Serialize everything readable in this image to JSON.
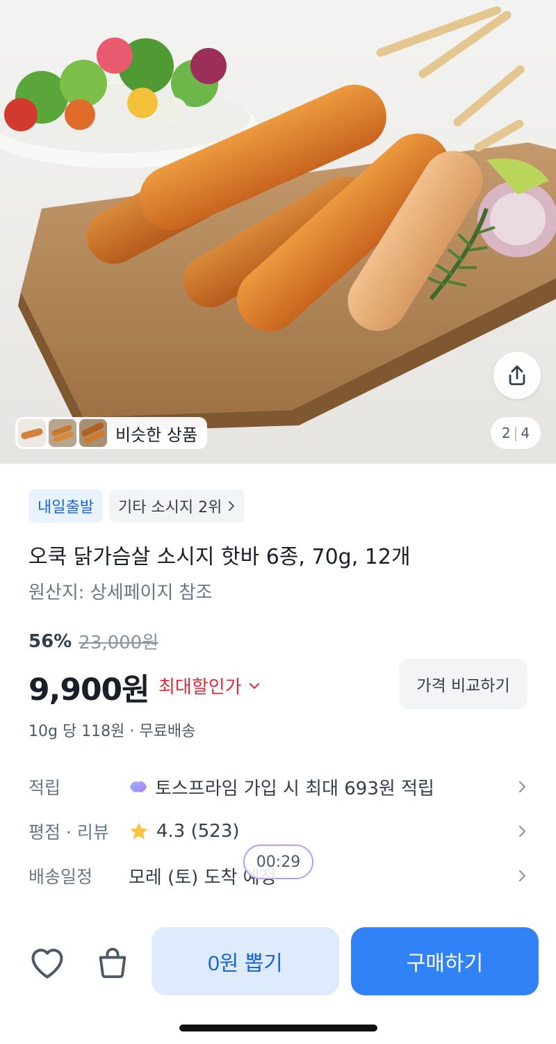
{
  "hero": {
    "image_alt": "sausage-skewers-on-board",
    "similar_label": "비슷한 상품",
    "pager_current": "2",
    "pager_total": "4",
    "pager_sep": "|"
  },
  "badges": {
    "departure": "내일출발",
    "rank": "기타 소시지 2위"
  },
  "product": {
    "title": "오쿡 닭가슴살 소시지 핫바 6종, 70g, 12개",
    "origin": "원산지: 상세페이지 참조"
  },
  "pricing": {
    "discount_pct": "56%",
    "original_price": "23,000원",
    "price": "9,900원",
    "max_discount_label": "최대할인가",
    "compare_label": "가격 비교하기",
    "unit_info": "10g 당 118원 · 무료배송"
  },
  "details": [
    {
      "key": "적립",
      "value": "토스프라임 가입 시 최대 693원 적립",
      "icon": "toss-prime-icon"
    },
    {
      "key": "평점 · 리뷰",
      "value": "4.3 (523)",
      "icon": "star-icon"
    },
    {
      "key": "배송일정",
      "value": "모레 (토) 도착 예정",
      "icon": ""
    }
  ],
  "timer": "00:29",
  "bottom_bar": {
    "draw_label": "0원 뽑기",
    "buy_label": "구매하기"
  },
  "colors": {
    "accent": "#3182f6",
    "accent_light": "#deebfd",
    "discount_red": "#e42939",
    "star": "#ffc342"
  }
}
